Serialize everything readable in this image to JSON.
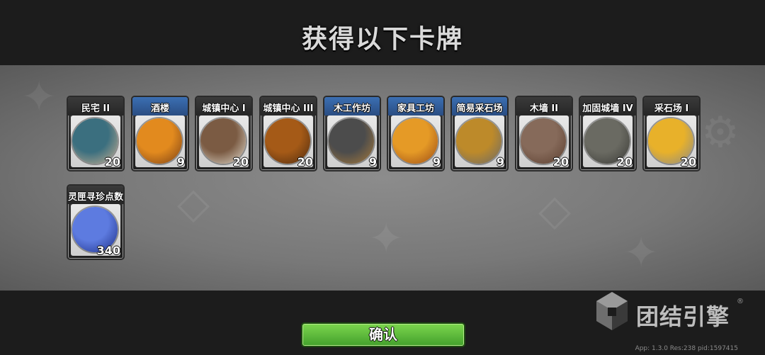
{
  "title": "获得以下卡牌",
  "cards": [
    {
      "name": "民宅 II",
      "count": "20",
      "header": "dark",
      "art_icon": "house-icon",
      "colors": [
        "#3b6f7f",
        "#c8b091"
      ]
    },
    {
      "name": "酒楼",
      "count": "9",
      "header": "blue",
      "art_icon": "tavern-icon",
      "colors": [
        "#e28a1e",
        "#7a3f16"
      ]
    },
    {
      "name": "城镇中心 I",
      "count": "20",
      "header": "dark",
      "art_icon": "town-center-1-icon",
      "colors": [
        "#7b5b43",
        "#e3ddd0"
      ]
    },
    {
      "name": "城镇中心 III",
      "count": "20",
      "header": "dark",
      "art_icon": "town-center-3-icon",
      "colors": [
        "#a55a17",
        "#4d2a0f"
      ]
    },
    {
      "name": "木工作坊",
      "count": "9",
      "header": "blue",
      "art_icon": "carpentry-workshop-icon",
      "colors": [
        "#4c4c4c",
        "#a97b3b"
      ]
    },
    {
      "name": "家具工坊",
      "count": "9",
      "header": "blue",
      "art_icon": "furniture-workshop-icon",
      "colors": [
        "#e59a26",
        "#9a4a16"
      ]
    },
    {
      "name": "简易采石场",
      "count": "9",
      "header": "blue",
      "art_icon": "simple-quarry-icon",
      "colors": [
        "#bd8a2a",
        "#6a6a6a"
      ]
    },
    {
      "name": "木墙 II",
      "count": "20",
      "header": "dark",
      "art_icon": "wood-wall-icon",
      "colors": [
        "#866a5a",
        "#5b3e2f"
      ]
    },
    {
      "name": "加固城墙 IV",
      "count": "20",
      "header": "dark",
      "art_icon": "reinforced-wall-icon",
      "colors": [
        "#6a6a62",
        "#3a3a36"
      ]
    },
    {
      "name": "采石场 I",
      "count": "20",
      "header": "dark",
      "art_icon": "quarry-icon",
      "colors": [
        "#e8b12a",
        "#8a8a8a"
      ]
    },
    {
      "name": "灵匣寻珍点数",
      "count": "340",
      "header": "dark",
      "art_icon": "spirit-box-icon",
      "colors": [
        "#5d7be0",
        "#1c2e86"
      ]
    }
  ],
  "confirm_label": "确认",
  "brand_text": "团结引擎",
  "brand_mark": "®",
  "app_info": "App: 1.3.0 Res:238 pid:1597415"
}
